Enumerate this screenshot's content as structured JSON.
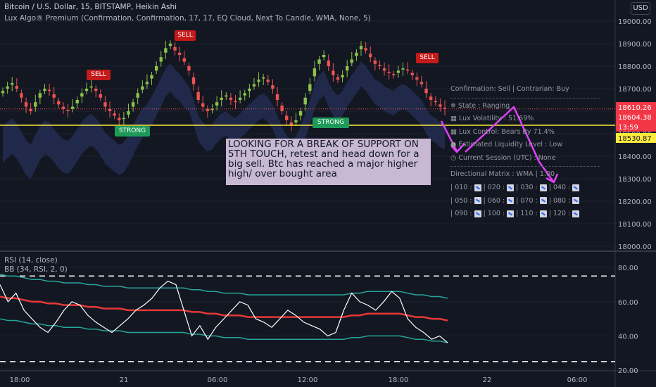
{
  "header": {
    "title": "Bitcoin / U.S. Dollar, 15, BITSTAMP, Heikin Ashi",
    "subtitle": "Lux Algo® Premium (Confirmation, Confirmation, 17, 17, EQ Cloud, Next To Candle, WMA, None, 5)",
    "currency": "USD"
  },
  "indicators": {
    "rsi_label": "RSI (14, close)",
    "bb_label": "BB (34, RSI, 2, 0)"
  },
  "annotation": {
    "text": "LOOKING FOR A BREAK OF SUPPORT ON 5TH TOUCH, retest and head down for a big sell. Btc has reached  a major higher high/ over bought area"
  },
  "signals": {
    "sell_label": "SELL",
    "strong_label": "STRONG"
  },
  "panel": {
    "confirmation": "Confirmation: Sell | Contrarian: Buy",
    "state": "State : Ranging",
    "volatility": "Lux Volatility : 51.69%",
    "control": "Lux Control: Bears By 71.4%",
    "liquidity": "Estimated Liquidity Level : Low",
    "session": "Current Session (UTC) : None",
    "matrix_title": "Directional Matrix : WMA | 1.00",
    "matrix_rows": [
      [
        "010",
        "020",
        "030",
        "040"
      ],
      [
        "050",
        "060",
        "070",
        "080"
      ],
      [
        "090",
        "100",
        "110",
        "120"
      ]
    ]
  },
  "colors": {
    "background": "#131722",
    "bull_candle": "#8bc34a",
    "bear_candle": "#ef5350",
    "ma_up": "#26a69a",
    "support_line": "#ffeb3b",
    "annotation_arrow": "#e040fb",
    "note_bg": "#c7b8d3",
    "rsi_line": "#ffffff",
    "bb_basis": "#e53935",
    "bb_band": "#26a69a"
  },
  "chart_data": [
    {
      "type": "candlestick",
      "title": "Bitcoin / U.S. Dollar, 15, BITSTAMP, Heikin Ashi",
      "ylim": [
        18000,
        19000
      ],
      "y_ticks": [
        18000,
        18100,
        18200,
        18300,
        18400,
        18500,
        18600,
        18700,
        18800,
        18900,
        19000
      ],
      "y_tick_labels": [
        "18000.00",
        "18100.00",
        "18200.00",
        "18300.00",
        "18400.00",
        "18500.00",
        "18600.00",
        "18700.00",
        "18800.00",
        "18900.00",
        "19000.00"
      ],
      "x_tick_labels": [
        "18:00",
        "21",
        "06:00",
        "12:00",
        "18:00",
        "22",
        "06:00"
      ],
      "price_labels": {
        "last_price": "18610.26",
        "second_price": "18604.38",
        "countdown": "13:59",
        "support_price": "18530.87"
      },
      "support_level": 18530.87,
      "candles_close": [
        18690,
        18710,
        18725,
        18700,
        18660,
        18620,
        18600,
        18640,
        18680,
        18700,
        18690,
        18660,
        18630,
        18610,
        18600,
        18620,
        18650,
        18680,
        18700,
        18710,
        18690,
        18660,
        18620,
        18600,
        18580,
        18560,
        18570,
        18600,
        18640,
        18680,
        18710,
        18730,
        18760,
        18800,
        18840,
        18880,
        18900,
        18870,
        18850,
        18820,
        18780,
        18720,
        18650,
        18620,
        18600,
        18610,
        18640,
        18660,
        18670,
        18650,
        18640,
        18660,
        18680,
        18700,
        18720,
        18740,
        18750,
        18730,
        18700,
        18650,
        18600,
        18560,
        18540,
        18560,
        18600,
        18660,
        18720,
        18790,
        18830,
        18850,
        18800,
        18760,
        18740,
        18760,
        18800,
        18830,
        18860,
        18890,
        18870,
        18840,
        18810,
        18800,
        18780,
        18770,
        18760,
        18780,
        18790,
        18780,
        18760,
        18740,
        18720,
        18680,
        18650,
        18640,
        18620,
        18610
      ]
    },
    {
      "type": "line",
      "title": "RSI (14, close)",
      "ylim": [
        20,
        85
      ],
      "y_ticks": [
        20,
        40,
        60,
        80
      ],
      "y_tick_labels": [
        "20.00",
        "40.00",
        "60.00",
        "80.00"
      ],
      "levels": [
        75,
        25
      ],
      "series": [
        {
          "name": "RSI (14, close)",
          "values": [
            70,
            60,
            65,
            55,
            50,
            45,
            42,
            48,
            55,
            60,
            58,
            52,
            48,
            45,
            42,
            46,
            50,
            55,
            58,
            62,
            68,
            72,
            70,
            55,
            40,
            46,
            38,
            45,
            50,
            55,
            60,
            58,
            50,
            48,
            45,
            50,
            55,
            52,
            48,
            46,
            44,
            40,
            42,
            55,
            65,
            60,
            58,
            55,
            60,
            66,
            62,
            50,
            45,
            42,
            38,
            40,
            36
          ]
        },
        {
          "name": "BB (34, RSI, 2, 0)",
          "values": [
            63,
            62,
            62,
            61,
            60,
            60,
            59,
            59,
            58,
            58,
            58,
            57,
            57,
            56,
            56,
            56,
            55,
            55,
            55,
            55,
            55,
            55,
            55,
            55,
            54,
            54,
            53,
            53,
            52,
            52,
            52,
            51,
            51,
            51,
            51,
            51,
            51,
            51,
            51,
            51,
            51,
            51,
            51,
            51,
            52,
            52,
            53,
            53,
            53,
            53,
            53,
            52,
            51,
            51,
            50,
            50,
            49
          ]
        }
      ]
    }
  ]
}
